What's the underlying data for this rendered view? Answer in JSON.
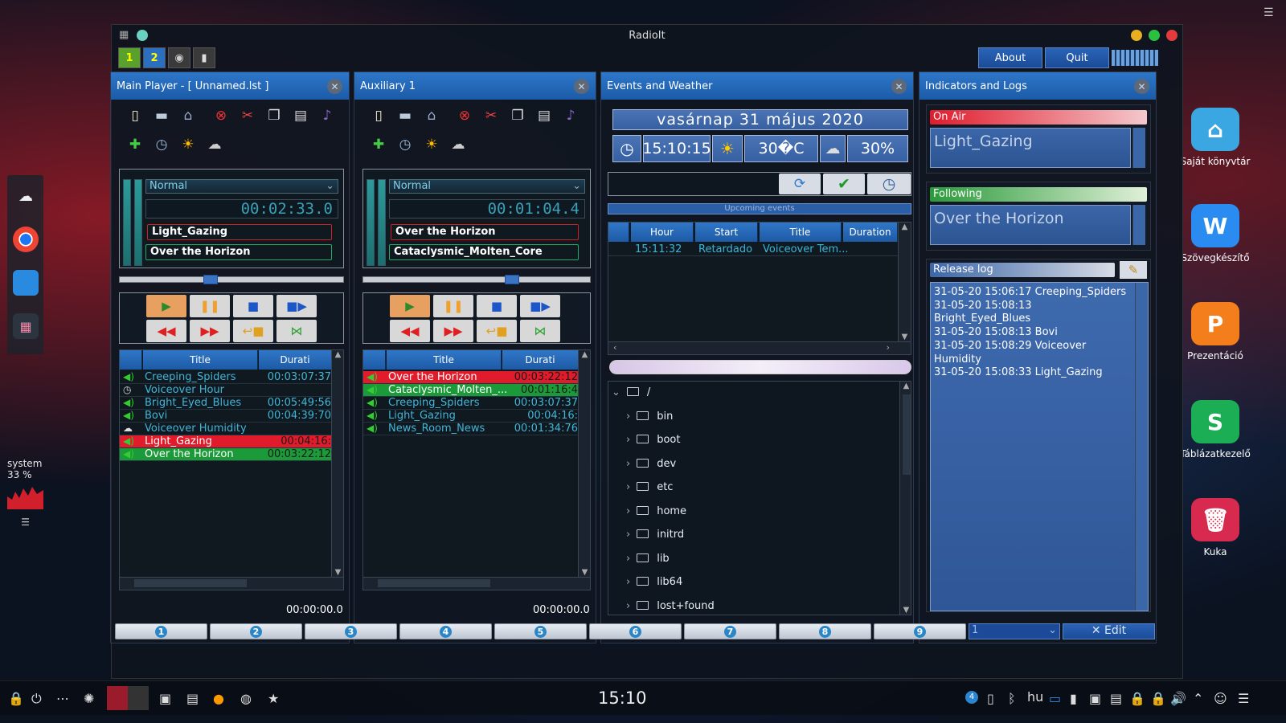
{
  "window": {
    "title": "RadioIt",
    "about": "About",
    "quit": "Quit"
  },
  "toolbar": {
    "btn1": "1",
    "btn2": "2"
  },
  "panels": {
    "main": {
      "title": "Main Player - [ Unnamed.lst ]",
      "mode": "Normal",
      "timer": "00:02:33.0",
      "track1": "Light_Gazing",
      "track2": "Over the Horizon",
      "col_title": "Title",
      "col_duration": "Durati",
      "footer_time": "00:00:00.0",
      "rows": [
        {
          "title": "Creeping_Spiders",
          "duration": "00:03:07:37",
          "icon": "speaker-icon",
          "state": "normal"
        },
        {
          "title": "Voiceover Hour",
          "duration": "",
          "icon": "clock-icon",
          "state": "normal"
        },
        {
          "title": "Bright_Eyed_Blues",
          "duration": "00:05:49:56",
          "icon": "speaker-icon",
          "state": "normal"
        },
        {
          "title": "Bovi",
          "duration": "00:04:39:70",
          "icon": "speaker-icon",
          "state": "normal"
        },
        {
          "title": "Voiceover Humidity",
          "duration": "",
          "icon": "cloud-icon",
          "state": "normal"
        },
        {
          "title": "Light_Gazing",
          "duration": "00:04:16:",
          "icon": "speaker-icon",
          "state": "onair"
        },
        {
          "title": "Over the Horizon",
          "duration": "00:03:22:12",
          "icon": "speaker-icon",
          "state": "next"
        }
      ]
    },
    "aux": {
      "title": "Auxiliary 1",
      "mode": "Normal",
      "timer": "00:01:04.4",
      "track1": "Over the Horizon",
      "track2": "Cataclysmic_Molten_Core",
      "col_title": "Title",
      "col_duration": "Durati",
      "footer_time": "00:00:00.0",
      "rows": [
        {
          "title": "Over the Horizon",
          "duration": "00:03:22:12",
          "icon": "speaker-icon",
          "state": "onair"
        },
        {
          "title": "Cataclysmic_Molten_...",
          "duration": "00:01:16:4",
          "icon": "speaker-icon",
          "state": "next"
        },
        {
          "title": "Creeping_Spiders",
          "duration": "00:03:07:37",
          "icon": "speaker-icon",
          "state": "normal"
        },
        {
          "title": "Light_Gazing",
          "duration": "00:04:16:",
          "icon": "speaker-icon",
          "state": "normal"
        },
        {
          "title": "News_Room_News",
          "duration": "00:01:34:76",
          "icon": "speaker-icon",
          "state": "normal"
        }
      ]
    },
    "events": {
      "title": "Events and Weather",
      "date": "vasárnap  31 május 2020",
      "time": "15:10:15",
      "temp": "30�C",
      "humidity": "30%",
      "upcoming": "Upcoming events",
      "cols": [
        "Hour",
        "Start",
        "Title",
        "Duration"
      ],
      "rows": [
        {
          "hour": "15:11:32",
          "start": "Retardado",
          "title": "Voiceover Tem..."
        }
      ],
      "tree": [
        "/",
        "bin",
        "boot",
        "dev",
        "etc",
        "home",
        "initrd",
        "lib",
        "lib64",
        "lost+found"
      ]
    },
    "indicators": {
      "title": "Indicators and Logs",
      "onair_label": "On Air",
      "onair_value": "Light_Gazing",
      "following_label": "Following",
      "following_value": "Over the Horizon",
      "log_label": "Release log",
      "log": [
        "31-05-20 15:06:17 Creeping_Spiders",
        "31-05-20 15:08:13",
        "Bright_Eyed_Blues",
        "31-05-20 15:08:13 Bovi",
        "31-05-20 15:08:29 Voiceover",
        "Humidity",
        "31-05-20 15:08:33 Light_Gazing"
      ]
    }
  },
  "bottom": {
    "buttons": [
      "1",
      "2",
      "3",
      "4",
      "5",
      "6",
      "7",
      "8",
      "9"
    ],
    "combo": "1",
    "edit": "✕ Edit"
  },
  "desktop": {
    "icons": [
      "Saját könyvtár",
      "Szövegkészítő",
      "Prezentáció",
      "Táblázatkezelő",
      "Kuka"
    ],
    "system_label": "system",
    "system_value": "33 %"
  },
  "taskbar": {
    "clock": "15:10",
    "lang": "hu",
    "badge": "4"
  },
  "colors": {
    "accent": "#2e77c9",
    "onair": "#e01c2c",
    "next": "#1c9a3a"
  }
}
